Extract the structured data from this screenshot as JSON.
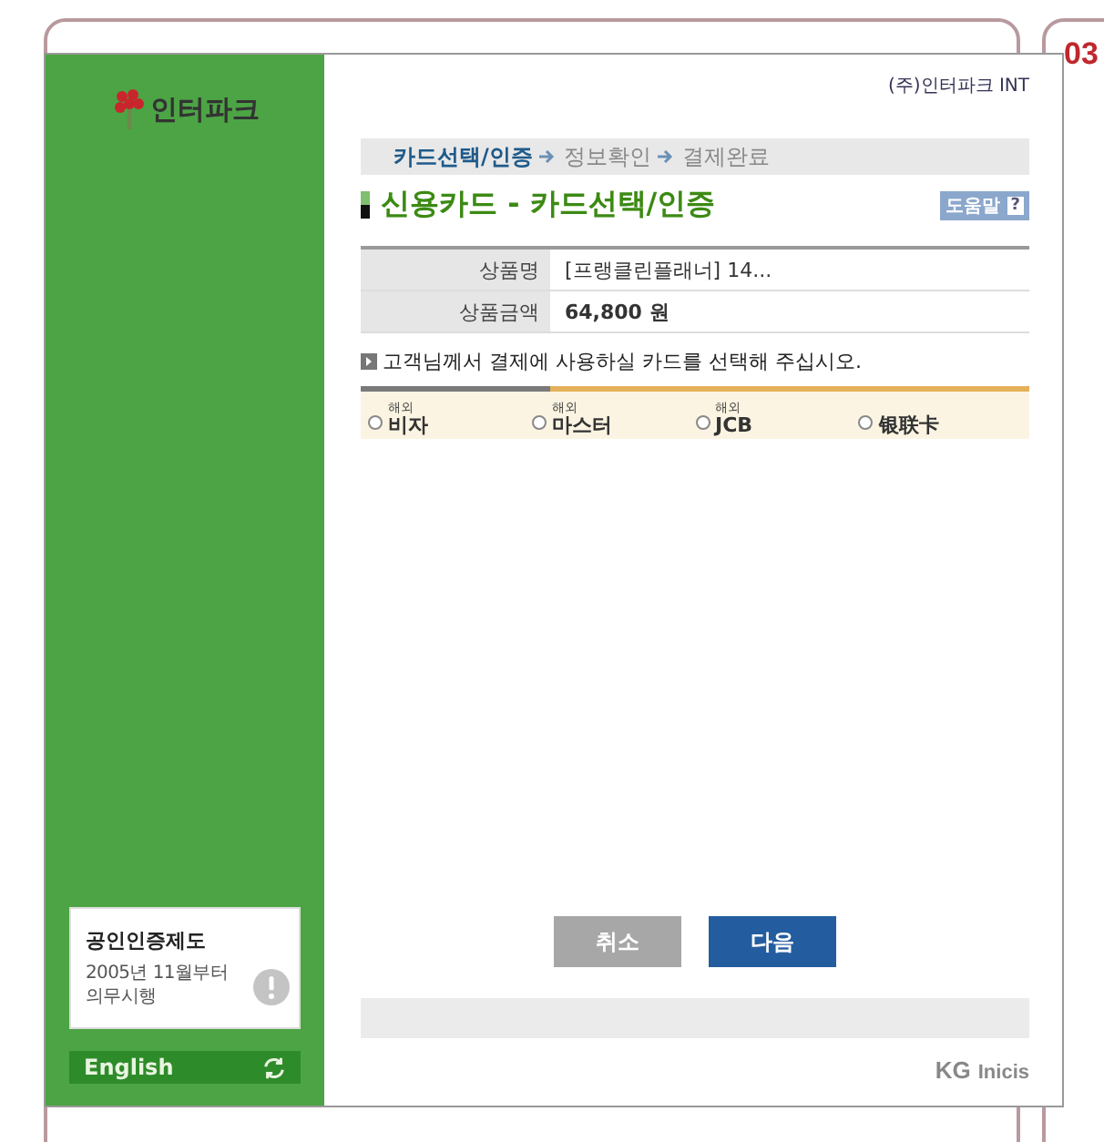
{
  "background": {
    "right_panel_heading": "03"
  },
  "dialog": {
    "sidebar": {
      "logo": "인터파크",
      "notice": {
        "title": "공인인증제도",
        "text": "2005년 11월부터\n의무시행"
      },
      "language_button": "English"
    },
    "company": "(주)인터파크 INT",
    "steps": [
      {
        "label": "카드선택/인증",
        "selected": true
      },
      {
        "label": "정보확인",
        "selected": false
      },
      {
        "label": "결제완료",
        "selected": false
      }
    ],
    "title": "신용카드 - 카드선택/인증",
    "help_button": "도움말",
    "help_icon": "?",
    "info_rows": [
      {
        "label": "상품명",
        "value": "[프랭클린플래너] 14...",
        "bold": false
      },
      {
        "label": "상품금액",
        "value": "64,800 원",
        "bold": true
      }
    ],
    "instruction": "고객님께서 결제에 사용하실 카드를 선택해 주십시오.",
    "cards": [
      {
        "tag": "해외",
        "name": "비자",
        "selected": false
      },
      {
        "tag": "해외",
        "name": "마스터",
        "selected": false
      },
      {
        "tag": "해외",
        "name": "JCB",
        "selected": false
      },
      {
        "name": "银联卡",
        "selected": false
      }
    ],
    "buttons": [
      {
        "label": "취소",
        "kind": "secondary"
      },
      {
        "label": "다음",
        "kind": "primary"
      }
    ],
    "footer_logo": {
      "mark": "KG",
      "name": "Inicis"
    }
  }
}
